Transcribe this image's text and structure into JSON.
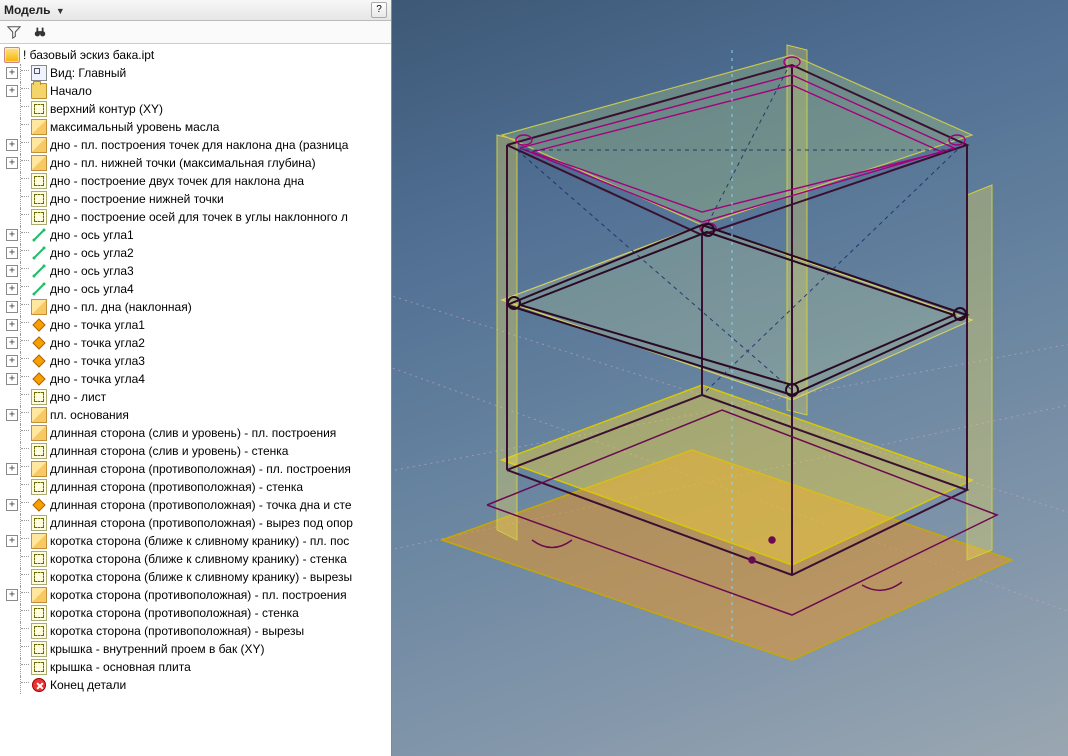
{
  "panel": {
    "title": "Модель",
    "help": "?"
  },
  "tree": {
    "root": "! базовый эскиз бака.ipt",
    "items": [
      {
        "exp": "+",
        "icon": "view",
        "label": "Вид: Главный"
      },
      {
        "exp": "+",
        "icon": "folder",
        "label": "Начало"
      },
      {
        "exp": "",
        "icon": "sketch",
        "label": "верхний контур (XY)"
      },
      {
        "exp": "",
        "icon": "plane",
        "label": "максимальный уровень масла"
      },
      {
        "exp": "+",
        "icon": "plane",
        "label": "дно - пл. построения точек для наклона дна (разница"
      },
      {
        "exp": "+",
        "icon": "plane",
        "label": "дно - пл. нижней точки (максимальная глубина)"
      },
      {
        "exp": "",
        "icon": "sketch",
        "label": "дно -  построение двух точек для наклона дна"
      },
      {
        "exp": "",
        "icon": "sketch",
        "label": "дно - построение нижней точки"
      },
      {
        "exp": "",
        "icon": "sketch",
        "label": "дно - построение осей для точек в углы наклонного л"
      },
      {
        "exp": "+",
        "icon": "axis",
        "label": "дно - ось угла1"
      },
      {
        "exp": "+",
        "icon": "axis",
        "label": "дно - ось угла2"
      },
      {
        "exp": "+",
        "icon": "axis",
        "label": "дно - ось угла3"
      },
      {
        "exp": "+",
        "icon": "axis",
        "label": "дно - ось угла4"
      },
      {
        "exp": "+",
        "icon": "plane",
        "label": "дно - пл. дна (наклонная)"
      },
      {
        "exp": "+",
        "icon": "point",
        "label": "дно - точка угла1"
      },
      {
        "exp": "+",
        "icon": "point",
        "label": "дно - точка угла2"
      },
      {
        "exp": "+",
        "icon": "point",
        "label": "дно - точка угла3"
      },
      {
        "exp": "+",
        "icon": "point",
        "label": "дно - точка угла4"
      },
      {
        "exp": "",
        "icon": "sketch",
        "label": "дно - лист"
      },
      {
        "exp": "+",
        "icon": "plane",
        "label": "пл. основания"
      },
      {
        "exp": "",
        "icon": "plane",
        "label": "длинная сторона (слив и уровень) - пл. построения"
      },
      {
        "exp": "",
        "icon": "sketch",
        "label": "длинная сторона (слив и уровень) - стенка"
      },
      {
        "exp": "+",
        "icon": "plane",
        "label": "длинная сторона (противоположная) - пл. построения"
      },
      {
        "exp": "",
        "icon": "sketch",
        "label": "длинная сторона (противоположная) - стенка"
      },
      {
        "exp": "+",
        "icon": "point",
        "label": "длинная сторона (противоположная) - точка дна и сте"
      },
      {
        "exp": "",
        "icon": "sketch",
        "label": "длинная сторона (противоположная) - вырез под опор"
      },
      {
        "exp": "+",
        "icon": "plane",
        "label": "коротка сторона (ближе к сливному кранику) - пл. пос"
      },
      {
        "exp": "",
        "icon": "sketch",
        "label": "коротка сторона (ближе к сливному кранику) - стенка"
      },
      {
        "exp": "",
        "icon": "sketch",
        "label": "коротка сторона (ближе к сливному кранику) - вырезы"
      },
      {
        "exp": "+",
        "icon": "plane",
        "label": "коротка сторона (противоположная) - пл. построения"
      },
      {
        "exp": "",
        "icon": "sketch",
        "label": "коротка сторона (противоположная) - стенка"
      },
      {
        "exp": "",
        "icon": "sketch",
        "label": "коротка сторона (противоположная) - вырезы"
      },
      {
        "exp": "",
        "icon": "sketch",
        "label": "крышка - внутренний проем в бак (XY)"
      },
      {
        "exp": "",
        "icon": "sketch",
        "label": "крышка - основная плита"
      },
      {
        "exp": "",
        "icon": "end",
        "label": "Конец детали"
      }
    ]
  }
}
